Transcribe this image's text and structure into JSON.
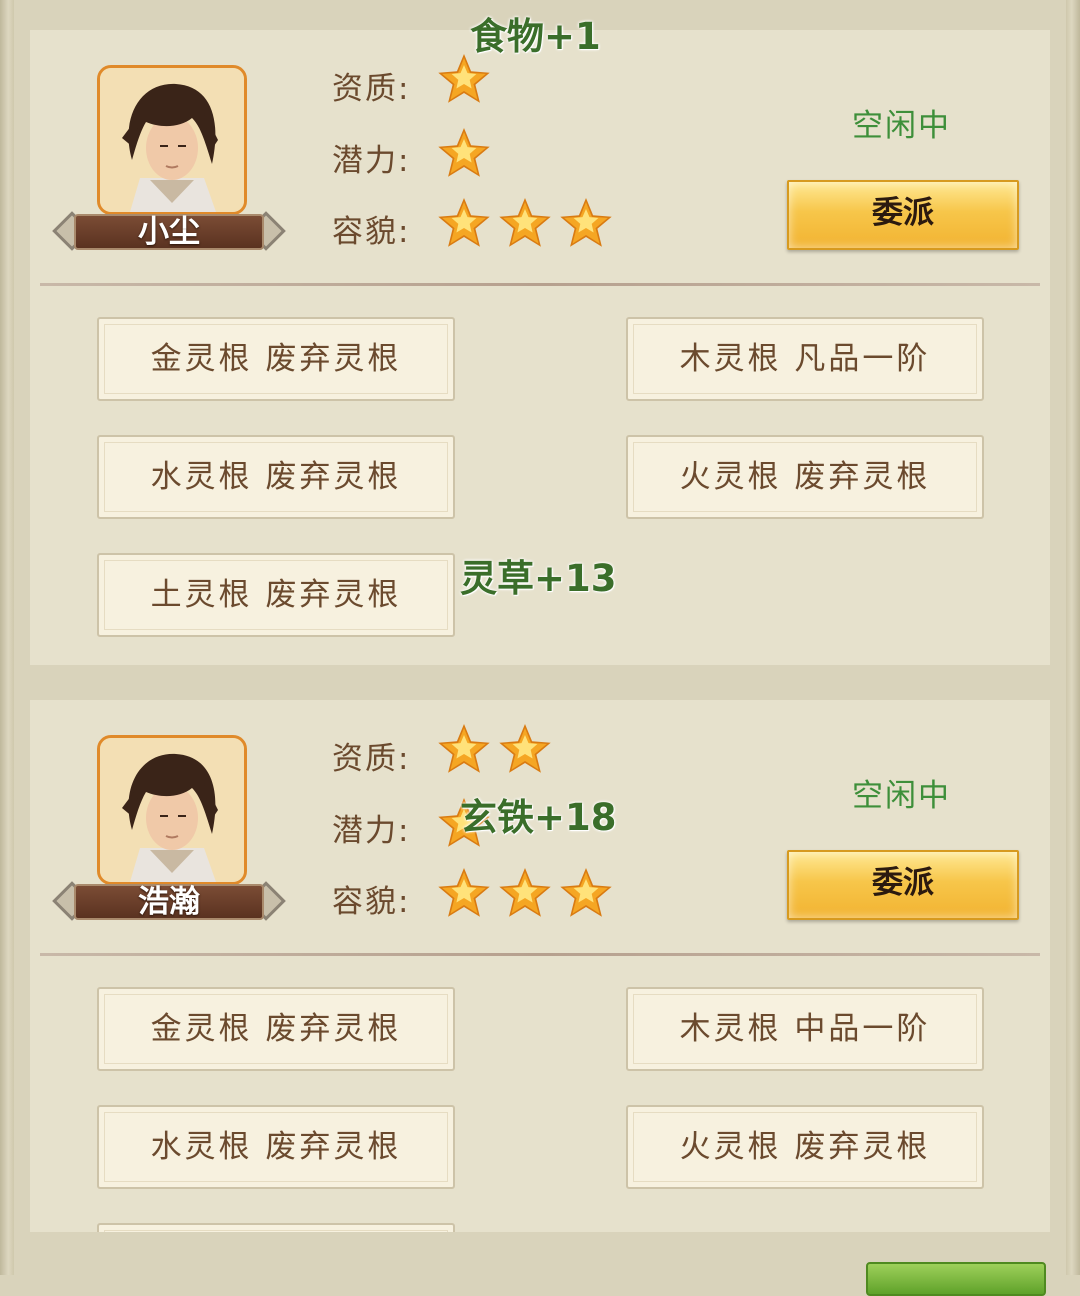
{
  "float_texts": {
    "food": "食物+1",
    "herb": "灵草+13",
    "iron": "玄铁+18"
  },
  "disciples": [
    {
      "name": "小尘",
      "labels": {
        "aptitude": "资质:",
        "potential": "潜力:",
        "looks": "容貌:"
      },
      "stars": {
        "aptitude": 1,
        "potential": 1,
        "looks": 3
      },
      "status": "空闲中",
      "assign_label": "委派",
      "roots": [
        "金灵根 废弃灵根",
        "木灵根 凡品一阶",
        "水灵根 废弃灵根",
        "火灵根 废弃灵根",
        "土灵根 废弃灵根"
      ]
    },
    {
      "name": "浩瀚",
      "labels": {
        "aptitude": "资质:",
        "potential": "潜力:",
        "looks": "容貌:"
      },
      "stars": {
        "aptitude": 2,
        "potential": 1,
        "looks": 3
      },
      "status": "空闲中",
      "assign_label": "委派",
      "roots": [
        "金灵根 废弃灵根",
        "木灵根 中品一阶",
        "水灵根 废弃灵根",
        "火灵根 废弃灵根"
      ]
    }
  ],
  "colors": {
    "status_green": "#3e8f3a",
    "star_gold": "#f5a623",
    "button_gold": "#f7c64a"
  }
}
